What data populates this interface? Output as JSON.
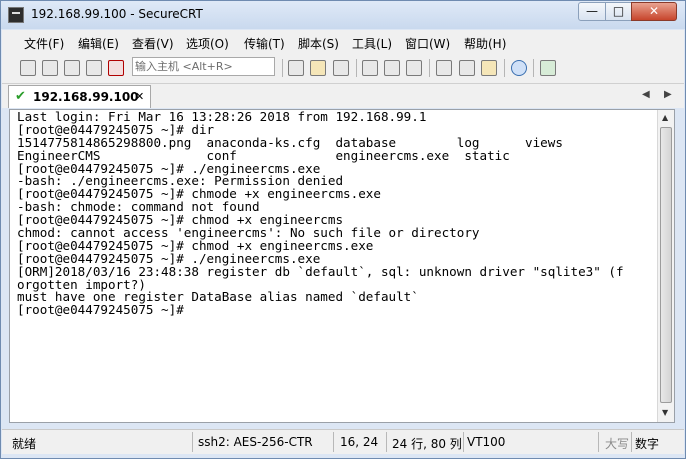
{
  "window": {
    "title": "192.168.99.100 - SecureCRT"
  },
  "menu": [
    "文件(F)",
    "编辑(E)",
    "查看(V)",
    "选项(O)",
    "传输(T)",
    "脚本(S)",
    "工具(L)",
    "窗口(W)",
    "帮助(H)"
  ],
  "toolbar": {
    "host_placeholder": "输入主机 <Alt+R>"
  },
  "tab": {
    "label": "192.168.99.100"
  },
  "terminal_lines": [
    "Last login: Fri Mar 16 13:28:26 2018 from 192.168.99.1",
    "[root@e04479245075 ~]# dir",
    "1514775814865298800.png  anaconda-ks.cfg  database        log      views",
    "EngineerCMS              conf             engineercms.exe  static",
    "[root@e04479245075 ~]# ./engineercms.exe",
    "-bash: ./engineercms.exe: Permission denied",
    "[root@e04479245075 ~]# chmode +x engineercms.exe",
    "-bash: chmode: command not found",
    "[root@e04479245075 ~]# chmod +x engineercms",
    "chmod: cannot access 'engineercms': No such file or directory",
    "[root@e04479245075 ~]# chmod +x engineercms.exe",
    "[root@e04479245075 ~]# ./engineercms.exe",
    "[ORM]2018/03/16 23:48:38 register db `default`, sql: unknown driver \"sqlite3\" (f",
    "orgotten import?)",
    "must have one register DataBase alias named `default`",
    "[root@e04479245075 ~]# "
  ],
  "status": {
    "ready": "就绪",
    "cipher": "ssh2: AES-256-CTR",
    "cursor": "16,  24",
    "rows_cols": "24 行, 80 列",
    "emulation": "VT100",
    "caps": "大写",
    "num": "数字"
  }
}
